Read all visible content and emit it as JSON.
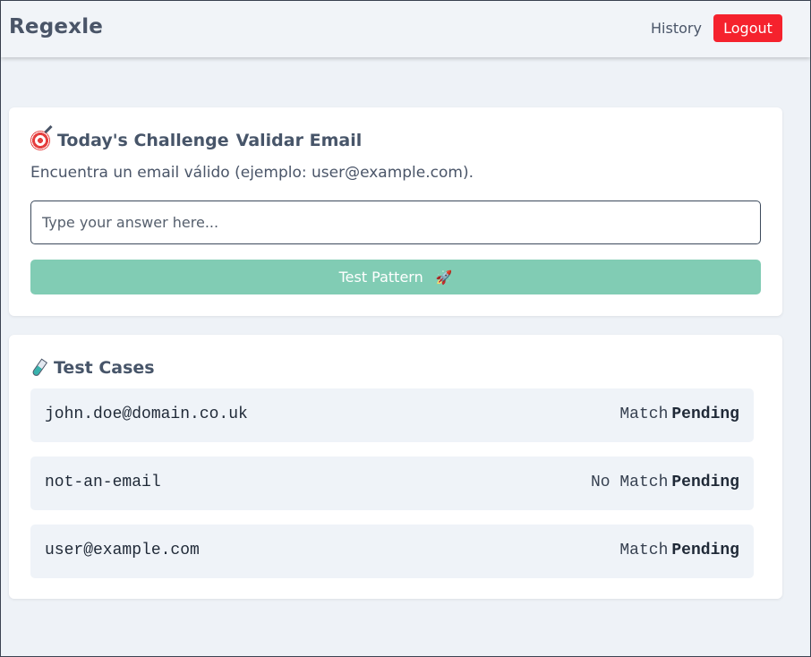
{
  "header": {
    "brand": "Regexle",
    "nav_history": "History",
    "logout_label": "Logout"
  },
  "challenge": {
    "heading": "Today's Challenge",
    "name": "Validar Email",
    "description": "Encuentra un email válido (ejemplo: user@example.com).",
    "input_placeholder": "Type your answer here...",
    "input_value": "",
    "test_button_label": "Test Pattern",
    "icon": "target-icon",
    "button_icon": "rocket-icon"
  },
  "test_cases": {
    "heading": "Test Cases",
    "icon": "test-tube-icon",
    "items": [
      {
        "text": "john.doe@domain.co.uk",
        "expected": "Match",
        "result": "Pending"
      },
      {
        "text": "not-an-email",
        "expected": "No Match",
        "result": "Pending"
      },
      {
        "text": "user@example.com",
        "expected": "Match",
        "result": "Pending"
      }
    ]
  },
  "colors": {
    "logout": "#f5222d",
    "test_button": "#81ccb4",
    "background": "#eef2f7"
  }
}
